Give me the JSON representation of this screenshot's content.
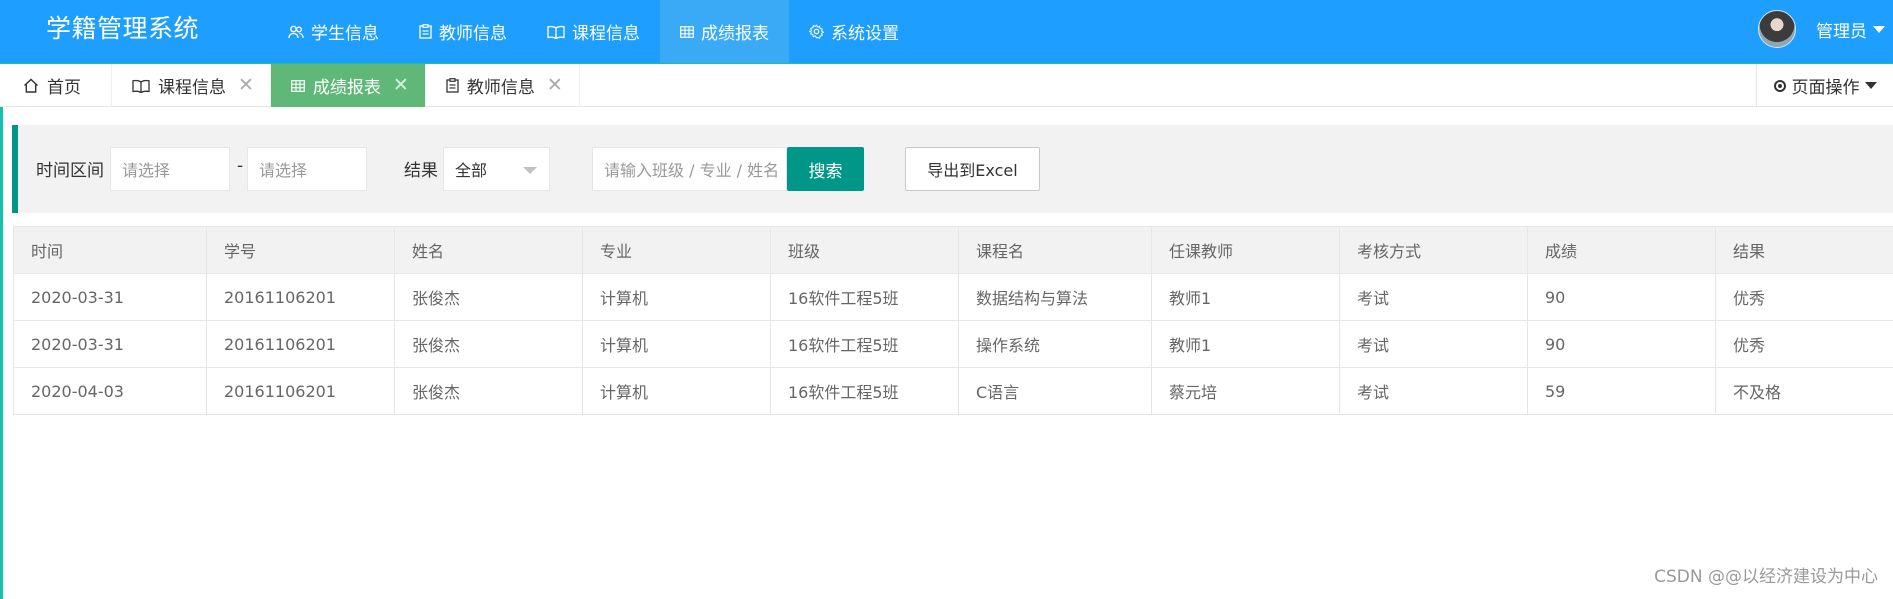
{
  "app": {
    "title": "学籍管理系统"
  },
  "nav": {
    "items": [
      {
        "label": "学生信息",
        "icon": "users-icon"
      },
      {
        "label": "教师信息",
        "icon": "clipboard-icon"
      },
      {
        "label": "课程信息",
        "icon": "book-icon"
      },
      {
        "label": "成绩报表",
        "icon": "table-icon",
        "active": true
      },
      {
        "label": "系统设置",
        "icon": "gear-icon"
      }
    ]
  },
  "user": {
    "name": "管理员"
  },
  "tabs": [
    {
      "label": "首页",
      "icon": "home-icon"
    },
    {
      "label": "课程信息",
      "icon": "book-icon"
    },
    {
      "label": "成绩报表",
      "icon": "table-icon",
      "active": true
    },
    {
      "label": "教师信息",
      "icon": "clipboard-icon"
    }
  ],
  "tab_close_glyph": "✕",
  "page_ops": {
    "label": "页面操作"
  },
  "search": {
    "time_label": "时间区间",
    "start_placeholder": "请选择",
    "range_sep": "-",
    "end_placeholder": "请选择",
    "result_label": "结果",
    "result_value": "全部",
    "keyword_placeholder": "请输入班级 / 专业 / 姓名",
    "search_button": "搜索",
    "export_button": "导出到Excel"
  },
  "table": {
    "columns": [
      "时间",
      "学号",
      "姓名",
      "专业",
      "班级",
      "课程名",
      "任课教师",
      "考核方式",
      "成绩",
      "结果"
    ],
    "rows": [
      [
        "2020-03-31",
        "20161106201",
        "张俊杰",
        "计算机",
        "16软件工程5班",
        "数据结构与算法",
        "教师1",
        "考试",
        "90",
        "优秀"
      ],
      [
        "2020-03-31",
        "20161106201",
        "张俊杰",
        "计算机",
        "16软件工程5班",
        "操作系统",
        "教师1",
        "考试",
        "90",
        "优秀"
      ],
      [
        "2020-04-03",
        "20161106201",
        "张俊杰",
        "计算机",
        "16软件工程5班",
        "C语言",
        "蔡元培",
        "考试",
        "59",
        "不及格"
      ]
    ]
  },
  "watermark": "CSDN @@以经济建设为中心",
  "colors": {
    "header": "#1E9FFF",
    "active_tab": "#5FB878",
    "primary_button": "#009688",
    "accent_line": "#13c2a8"
  }
}
